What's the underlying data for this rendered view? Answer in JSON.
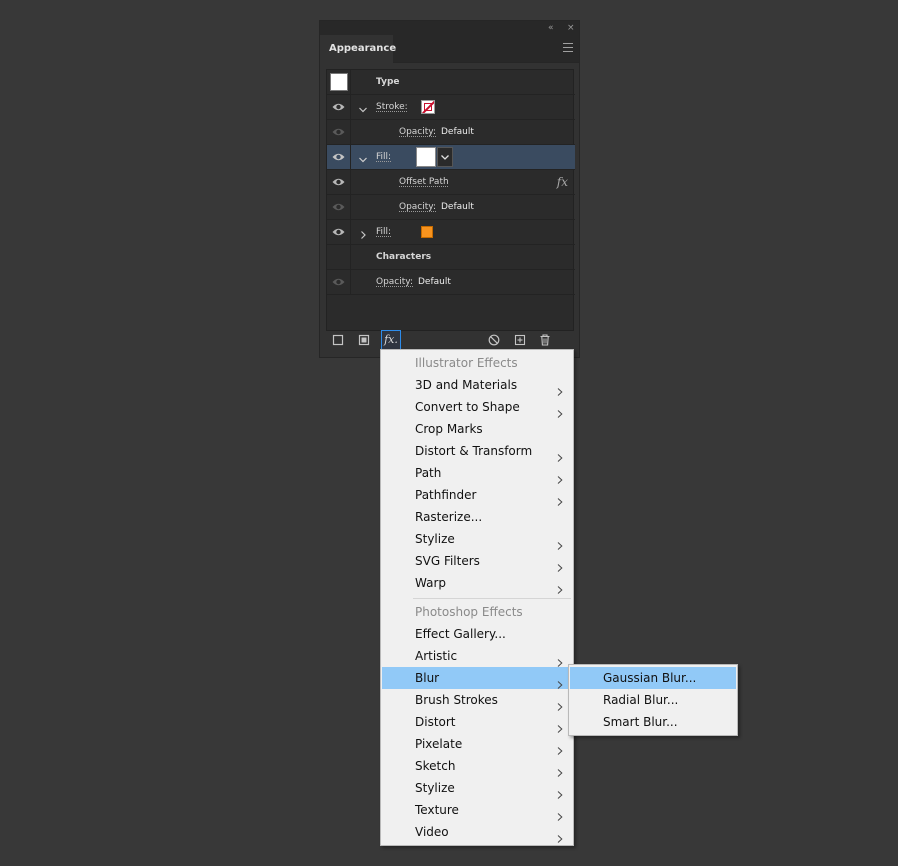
{
  "panel": {
    "tab_title": "Appearance",
    "collapse_glyph": "«",
    "close_glyph": "×"
  },
  "rows": {
    "type_label": "Type",
    "stroke_label": "Stroke:",
    "opacity1_label": "Opacity:",
    "opacity1_value": "Default",
    "fill1_label": "Fill:",
    "offset_path_label": "Offset Path",
    "fx_glyph": "fx",
    "opacity2_label": "Opacity:",
    "opacity2_value": "Default",
    "fill2_label": "Fill:",
    "characters_label": "Characters",
    "opacity3_label": "Opacity:",
    "opacity3_value": "Default"
  },
  "colors": {
    "stroke_swatch": "#c8102e",
    "fill2_swatch": "#f7931e",
    "selected_row": "#3a4b60",
    "menu_highlight": "#91c9f7"
  },
  "toolbar": {
    "fx_label": "fx."
  },
  "effects_menu": {
    "illustrator_heading": "Illustrator Effects",
    "illustrator_items": [
      {
        "label": "3D and Materials",
        "submenu": true
      },
      {
        "label": "Convert to Shape",
        "submenu": true
      },
      {
        "label": "Crop Marks",
        "submenu": false
      },
      {
        "label": "Distort & Transform",
        "submenu": true
      },
      {
        "label": "Path",
        "submenu": true
      },
      {
        "label": "Pathfinder",
        "submenu": true
      },
      {
        "label": "Rasterize...",
        "submenu": false
      },
      {
        "label": "Stylize",
        "submenu": true
      },
      {
        "label": "SVG Filters",
        "submenu": true
      },
      {
        "label": "Warp",
        "submenu": true
      }
    ],
    "photoshop_heading": "Photoshop Effects",
    "photoshop_items": [
      {
        "label": "Effect Gallery...",
        "submenu": false
      },
      {
        "label": "Artistic",
        "submenu": true
      },
      {
        "label": "Blur",
        "submenu": true,
        "highlighted": true
      },
      {
        "label": "Brush Strokes",
        "submenu": true
      },
      {
        "label": "Distort",
        "submenu": true
      },
      {
        "label": "Pixelate",
        "submenu": true
      },
      {
        "label": "Sketch",
        "submenu": true
      },
      {
        "label": "Stylize",
        "submenu": true
      },
      {
        "label": "Texture",
        "submenu": true
      },
      {
        "label": "Video",
        "submenu": true
      }
    ]
  },
  "blur_submenu": {
    "items": [
      {
        "label": "Gaussian Blur...",
        "highlighted": true
      },
      {
        "label": "Radial Blur...",
        "highlighted": false
      },
      {
        "label": "Smart Blur...",
        "highlighted": false
      }
    ]
  }
}
